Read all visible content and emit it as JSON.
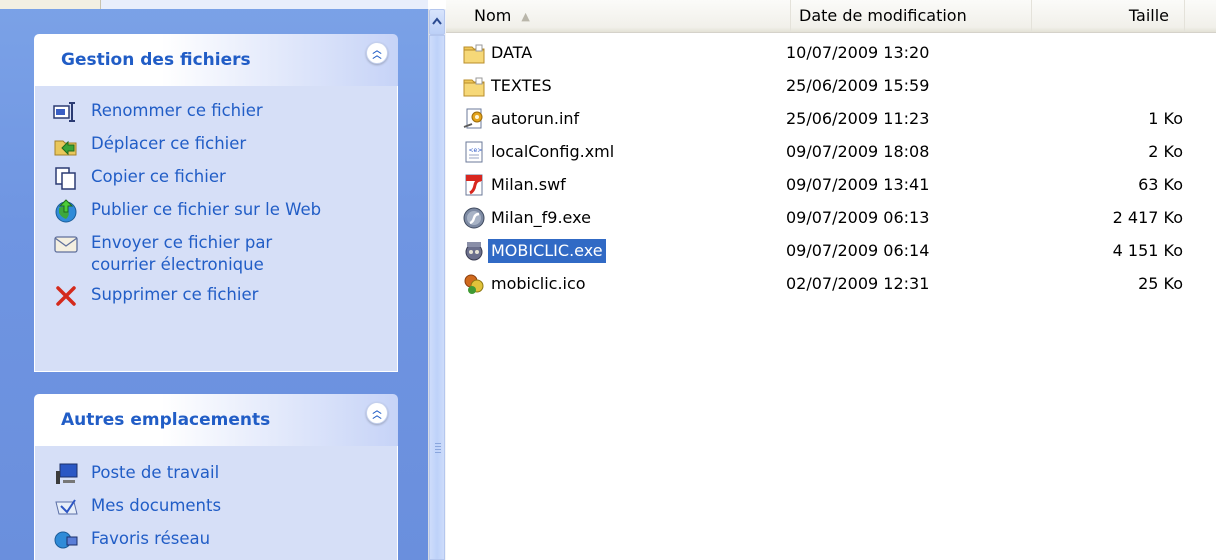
{
  "task_pane": {
    "file_tasks": {
      "title": "Gestion des fichiers",
      "items": [
        {
          "label": "Renommer ce fichier",
          "icon": "rename-icon"
        },
        {
          "label": "Déplacer ce fichier",
          "icon": "move-icon"
        },
        {
          "label": "Copier ce fichier",
          "icon": "copy-icon"
        },
        {
          "label": "Publier ce fichier sur le Web",
          "icon": "publish-web-icon"
        },
        {
          "label": "Envoyer ce fichier par\ncourrier électronique",
          "icon": "email-icon"
        },
        {
          "label": "Supprimer ce fichier",
          "icon": "delete-icon"
        }
      ]
    },
    "other_places": {
      "title": "Autres emplacements",
      "items": [
        {
          "label": "Poste de travail",
          "icon": "my-computer-icon"
        },
        {
          "label": "Mes documents",
          "icon": "my-documents-icon"
        },
        {
          "label": "Favoris réseau",
          "icon": "network-places-icon"
        }
      ]
    }
  },
  "file_list": {
    "columns": {
      "name": "Nom",
      "date": "Date de modification",
      "size": "Taille"
    },
    "sort_column": "name",
    "sort_direction": "ascending",
    "rows": [
      {
        "name": "DATA",
        "date": "10/07/2009 13:20",
        "size": "",
        "icon": "folder-icon"
      },
      {
        "name": "TEXTES",
        "date": "25/06/2009 15:59",
        "size": "",
        "icon": "folder-icon"
      },
      {
        "name": "autorun.inf",
        "date": "25/06/2009 11:23",
        "size": "1 Ko",
        "icon": "settings-file-icon"
      },
      {
        "name": "localConfig.xml",
        "date": "09/07/2009 18:08",
        "size": "2 Ko",
        "icon": "xml-file-icon"
      },
      {
        "name": "Milan.swf",
        "date": "09/07/2009 13:41",
        "size": "63 Ko",
        "icon": "flash-file-icon"
      },
      {
        "name": "Milan_f9.exe",
        "date": "09/07/2009 06:13",
        "size": "2 417 Ko",
        "icon": "flash-exe-icon"
      },
      {
        "name": "MOBICLIC.exe",
        "date": "09/07/2009 06:14",
        "size": "4 151 Ko",
        "icon": "mobiclic-app-icon",
        "selected": true
      },
      {
        "name": "mobiclic.ico",
        "date": "02/07/2009 12:31",
        "size": "25 Ko",
        "icon": "mobiclic-ico-icon"
      }
    ]
  },
  "colors": {
    "link": "#215dc6",
    "selection": "#316ac5",
    "pane_background": "#6f95e2",
    "panel_body": "#d6dff7"
  }
}
